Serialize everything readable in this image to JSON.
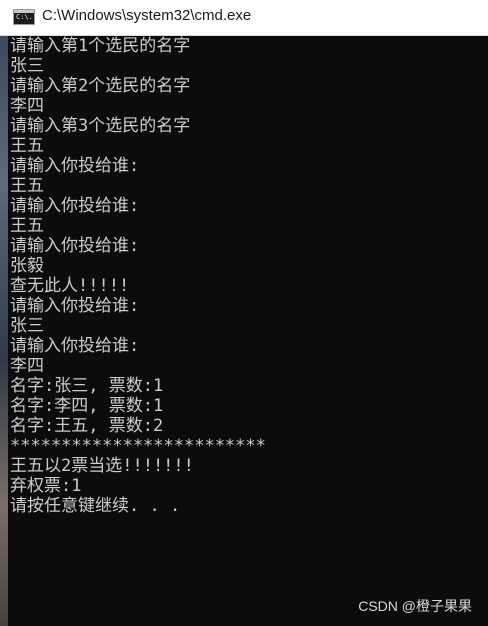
{
  "window": {
    "title": "C:\\Windows\\system32\\cmd.exe",
    "icon": "cmd-icon",
    "icon_label": "C:\\."
  },
  "console": {
    "lines": [
      "请输入第1个选民的名字",
      "张三",
      "请输入第2个选民的名字",
      "李四",
      "请输入第3个选民的名字",
      "王五",
      "请输入你投给谁:",
      "王五",
      "请输入你投给谁:",
      "王五",
      "请输入你投给谁:",
      "张毅",
      "查无此人!!!!!",
      "请输入你投给谁:",
      "张三",
      "请输入你投给谁:",
      "李四",
      "名字:张三, 票数:1",
      "名字:李四, 票数:1",
      "名字:王五, 票数:2",
      "*************************",
      "王五以2票当选!!!!!!!",
      "弃权票:1",
      "请按任意键继续. . ."
    ]
  },
  "watermark": "CSDN @橙子果果",
  "colors": {
    "console_bg": "#0c0c0c",
    "console_text": "#cccccc",
    "titlebar_bg": "#ffffff"
  }
}
